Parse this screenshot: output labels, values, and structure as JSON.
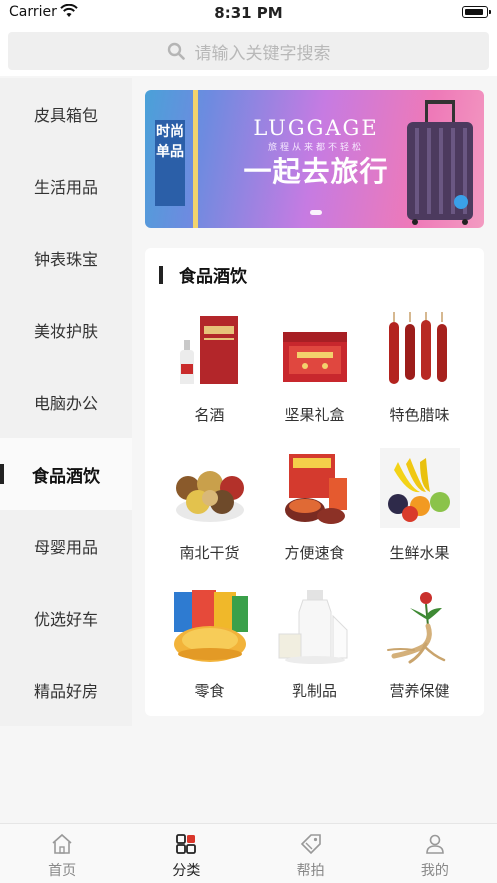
{
  "status": {
    "carrier": "Carrier",
    "time": "8:31 PM",
    "battery_level": 0.9
  },
  "search": {
    "placeholder": "请输入关键字搜索",
    "icon": "search-icon"
  },
  "sidebar": {
    "items": [
      {
        "label": "皮具箱包"
      },
      {
        "label": "生活用品"
      },
      {
        "label": "钟表珠宝"
      },
      {
        "label": "美妆护肤"
      },
      {
        "label": "电脑办公"
      },
      {
        "label": "食品酒饮",
        "active": true
      },
      {
        "label": "母婴用品"
      },
      {
        "label": "优选好车"
      },
      {
        "label": "精品好房"
      }
    ]
  },
  "banner": {
    "side_text": "时尚单品",
    "title_en": "LUGGAGE",
    "subtitle": "旅程从来都不轻松",
    "title_cn": "一起去旅行"
  },
  "category": {
    "title": "食品酒饮",
    "items": [
      {
        "label": "名酒",
        "icon": "liquor-icon"
      },
      {
        "label": "坚果礼盒",
        "icon": "nut-gift-box-icon"
      },
      {
        "label": "特色腊味",
        "icon": "sausage-icon"
      },
      {
        "label": "南北干货",
        "icon": "dried-goods-icon"
      },
      {
        "label": "方便速食",
        "icon": "instant-food-icon"
      },
      {
        "label": "生鲜水果",
        "icon": "fruit-icon"
      },
      {
        "label": "零食",
        "icon": "snack-chips-icon"
      },
      {
        "label": "乳制品",
        "icon": "dairy-icon"
      },
      {
        "label": "营养保健",
        "icon": "ginseng-icon"
      }
    ]
  },
  "tabbar": {
    "items": [
      {
        "label": "首页",
        "icon": "home-icon"
      },
      {
        "label": "分类",
        "icon": "category-icon",
        "active": true
      },
      {
        "label": "帮拍",
        "icon": "tag-icon"
      },
      {
        "label": "我的",
        "icon": "user-icon"
      }
    ]
  }
}
